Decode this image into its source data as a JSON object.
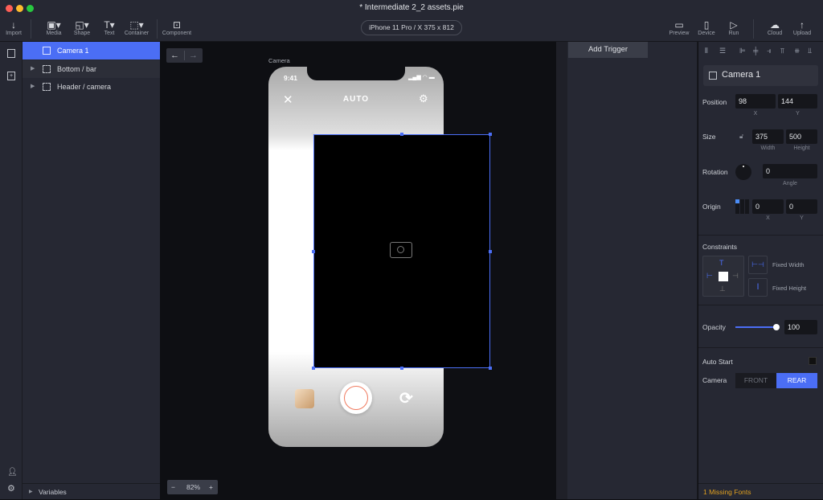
{
  "window": {
    "title": "* Intermediate 2_2 assets.pie"
  },
  "toolbar": {
    "import": "Import",
    "media": "Media",
    "shape": "Shape",
    "text": "Text",
    "container": "Container",
    "component": "Component",
    "device": "iPhone 11 Pro / X  375 x 812",
    "preview": "Preview",
    "device_btn": "Device",
    "run": "Run",
    "cloud": "Cloud",
    "upload": "Upload"
  },
  "layers": {
    "items": [
      {
        "label": "Camera 1",
        "selected": true
      },
      {
        "label": "Bottom / bar"
      },
      {
        "label": "Header / camera"
      }
    ],
    "variables": "Variables"
  },
  "canvas": {
    "artboard_label": "Camera",
    "status_time": "9:41",
    "mode": "AUTO",
    "zoom": "82%",
    "zoom_out": "−",
    "zoom_in": "+"
  },
  "triggers": {
    "add": "Add Trigger"
  },
  "inspector": {
    "name": "Camera 1",
    "position_label": "Position",
    "x": "98",
    "y": "144",
    "x_label": "X",
    "y_label": "Y",
    "size_label": "Size",
    "width": "375",
    "height": "500",
    "width_label": "Width",
    "height_label": "Height",
    "rotation_label": "Rotation",
    "angle": "0",
    "angle_label": "Angle",
    "origin_label": "Origin",
    "origin_x": "0",
    "origin_y": "0",
    "constraints_label": "Constraints",
    "fixed_width": "Fixed Width",
    "fixed_height": "Fixed Height",
    "opacity_label": "Opacity",
    "opacity": "100",
    "auto_start": "Auto Start",
    "camera_label": "Camera",
    "front": "FRONT",
    "rear": "REAR",
    "selected_camera": "REAR",
    "missing_fonts": "1 Missing Fonts"
  },
  "colors": {
    "accent": "#4b6ef5",
    "warning": "#e0a020"
  }
}
